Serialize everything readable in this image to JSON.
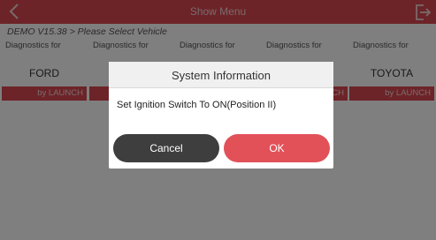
{
  "header": {
    "title": "Show Menu",
    "back_icon": "chevron-left-icon",
    "exit_icon": "exit-icon"
  },
  "breadcrumb": "DEMO V15.38 > Please Select  Vehicle",
  "vehicles": [
    {
      "header": "Diagnostics for",
      "brand": "FORD",
      "footer": "by LAUNCH"
    },
    {
      "header": "Diagnostics for",
      "brand": "",
      "footer": ""
    },
    {
      "header": "Diagnostics for",
      "brand": "",
      "footer": ""
    },
    {
      "header": "Diagnostics for",
      "brand": "",
      "footer": "CH"
    },
    {
      "header": "Diagnostics for",
      "brand": "TOYOTA",
      "footer": "by LAUNCH"
    }
  ],
  "dialog": {
    "title": "System Information",
    "message": "Set Ignition Switch To ON(Position II)",
    "cancel_label": "Cancel",
    "ok_label": "OK"
  },
  "colors": {
    "accent": "#d84850",
    "ok_button": "#e25158",
    "cancel_button": "#3e3e3e"
  }
}
